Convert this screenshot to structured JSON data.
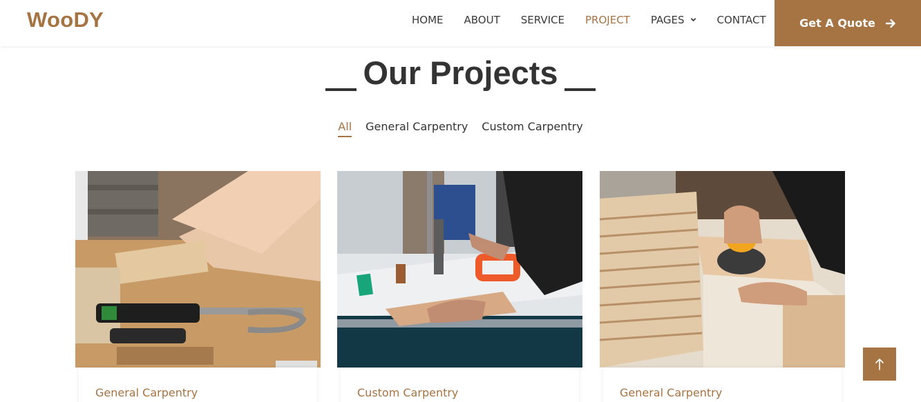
{
  "brand": "WooDY",
  "nav": {
    "items": [
      {
        "label": "HOME",
        "active": false
      },
      {
        "label": "ABOUT",
        "active": false
      },
      {
        "label": "SERVICE",
        "active": false
      },
      {
        "label": "PROJECT",
        "active": true
      },
      {
        "label": "PAGES",
        "active": false
      },
      {
        "label": "CONTACT",
        "active": false
      }
    ],
    "quote_label": "Get A Quote"
  },
  "section": {
    "title": "Our Projects"
  },
  "filters": [
    {
      "label": "All",
      "active": true
    },
    {
      "label": "General Carpentry",
      "active": false
    },
    {
      "label": "Custom Carpentry",
      "active": false
    }
  ],
  "projects": [
    {
      "category": "General Carpentry"
    },
    {
      "category": "Custom Carpentry"
    },
    {
      "category": "General Carpentry"
    }
  ],
  "colors": {
    "accent": "#a67343",
    "text": "#333333"
  }
}
